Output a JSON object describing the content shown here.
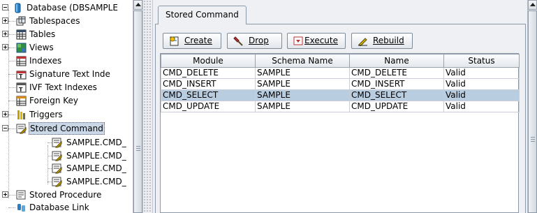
{
  "tree": {
    "root_label": "Database (DBSAMPLE",
    "items": [
      {
        "label": "Tablespaces",
        "icon": "tablespaces-icon",
        "expandable": true
      },
      {
        "label": "Tables",
        "icon": "tables-icon",
        "expandable": true
      },
      {
        "label": "Views",
        "icon": "views-icon",
        "expandable": true
      },
      {
        "label": "Indexes",
        "icon": "indexes-icon",
        "expandable": false
      },
      {
        "label": "Signature Text Inde",
        "icon": "signature-text-index-icon",
        "expandable": false
      },
      {
        "label": "IVF Text Indexes",
        "icon": "ivf-text-index-icon",
        "expandable": false
      },
      {
        "label": "Foreign Key",
        "icon": "foreign-key-icon",
        "expandable": false
      },
      {
        "label": "Triggers",
        "icon": "triggers-icon",
        "expandable": true
      },
      {
        "label": "Stored Command",
        "icon": "stored-command-icon",
        "expandable": true,
        "expanded": true,
        "selected": true
      },
      {
        "label": "SAMPLE.CMD_",
        "icon": "stored-command-item-icon",
        "child": true
      },
      {
        "label": "SAMPLE.CMD_",
        "icon": "stored-command-item-icon",
        "child": true
      },
      {
        "label": "SAMPLE.CMD_",
        "icon": "stored-command-item-icon",
        "child": true
      },
      {
        "label": "SAMPLE.CMD_",
        "icon": "stored-command-item-icon",
        "child": true
      },
      {
        "label": "Stored Procedure",
        "icon": "stored-procedure-icon",
        "expandable": true
      },
      {
        "label": "Database Link",
        "icon": "database-link-icon",
        "expandable": false
      }
    ]
  },
  "tab": {
    "label": "Stored Command"
  },
  "toolbar": {
    "create_label": "Create",
    "drop_label": "Drop",
    "execute_label": "Execute",
    "rebuild_label": "Rebuild"
  },
  "table": {
    "columns": [
      "Module",
      "Schema Name",
      "Name",
      "Status"
    ],
    "rows": [
      [
        "CMD_DELETE",
        "SAMPLE",
        "CMD_DELETE",
        "Valid"
      ],
      [
        "CMD_INSERT",
        "SAMPLE",
        "CMD_INSERT",
        "Valid"
      ],
      [
        "CMD_SELECT",
        "SAMPLE",
        "CMD_SELECT",
        "Valid"
      ],
      [
        "CMD_UPDATE",
        "SAMPLE",
        "CMD_UPDATE",
        "Valid"
      ]
    ],
    "selected_row": 2
  },
  "colors": {
    "selection": "#b9cde1",
    "panel_background": "#eef0f3"
  }
}
